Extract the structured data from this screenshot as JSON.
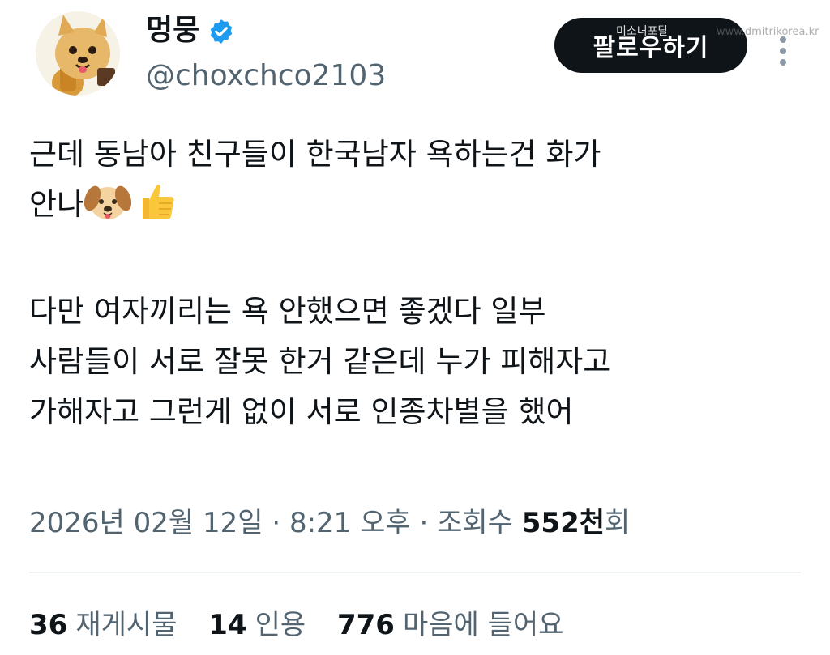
{
  "profile": {
    "display_name": "멍뭉",
    "handle": "@choxchco2103",
    "verified_color": "#1d9bf0"
  },
  "header": {
    "follow_label": "팔로우하기",
    "more_icon": "more-vertical-icon"
  },
  "watermark": {
    "text": "미소녀포탈",
    "url": "www.dmitrikorea.kr"
  },
  "tweet": {
    "line1": "근데 동남아 친구들이 한국남자 욕하는건 화가",
    "line2": "안나",
    "line2_emojis": [
      "dog-face-emoji",
      "thumbs-up-emoji"
    ],
    "line3": "다만 여자끼리는 욕 안했으면 좋겠다 일부",
    "line4": "사람들이 서로 잘못 한거 같은데 누가 피해자고",
    "line5": "가해자고 그런게 없이 서로 인종차별을 했어"
  },
  "meta": {
    "date": "2026년 02월 12일",
    "sep1": " · ",
    "time": "8:21 오후",
    "sep2": " · ",
    "views_label": "조회수 ",
    "views_count": "552천",
    "views_suffix": "회"
  },
  "stats": {
    "retweets_count": "36",
    "retweets_label": "재게시물",
    "quotes_count": "14",
    "quotes_label": "인용",
    "likes_count": "776",
    "likes_label": "마음에 들어요"
  },
  "colors": {
    "text_primary": "#0f1419",
    "text_secondary": "#536471",
    "follow_bg": "#0f1419",
    "divider": "#eff3f4"
  }
}
